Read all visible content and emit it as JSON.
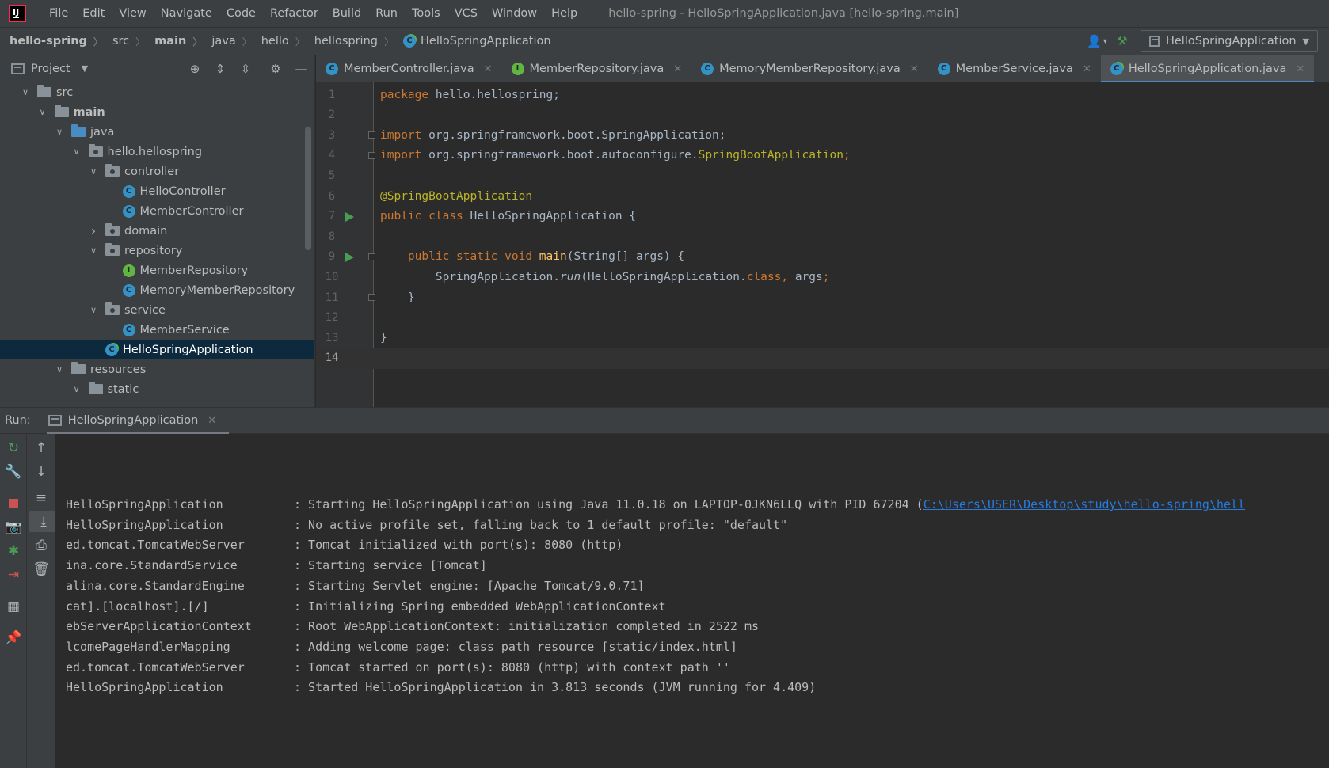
{
  "menubar": {
    "items": [
      "File",
      "Edit",
      "View",
      "Navigate",
      "Code",
      "Refactor",
      "Build",
      "Run",
      "Tools",
      "VCS",
      "Window",
      "Help"
    ],
    "window_title": "hello-spring - HelloSpringApplication.java [hello-spring.main]"
  },
  "breadcrumbs": [
    "hello-spring",
    "src",
    "main",
    "java",
    "hello",
    "hellospring",
    "HelloSpringApplication"
  ],
  "run_config": {
    "label": "HelloSpringApplication"
  },
  "project_panel": {
    "title": "Project",
    "tree": [
      {
        "label": "src",
        "depth": 1,
        "kind": "folder",
        "expanded": true
      },
      {
        "label": "main",
        "depth": 2,
        "kind": "folder",
        "expanded": true,
        "bold": true
      },
      {
        "label": "java",
        "depth": 3,
        "kind": "src-folder",
        "expanded": true
      },
      {
        "label": "hello.hellospring",
        "depth": 4,
        "kind": "package",
        "expanded": true
      },
      {
        "label": "controller",
        "depth": 5,
        "kind": "package",
        "expanded": true
      },
      {
        "label": "HelloController",
        "depth": 6,
        "kind": "class"
      },
      {
        "label": "MemberController",
        "depth": 6,
        "kind": "class"
      },
      {
        "label": "domain",
        "depth": 5,
        "kind": "package",
        "expanded": false
      },
      {
        "label": "repository",
        "depth": 5,
        "kind": "package",
        "expanded": true
      },
      {
        "label": "MemberRepository",
        "depth": 6,
        "kind": "interface"
      },
      {
        "label": "MemoryMemberRepository",
        "depth": 6,
        "kind": "class"
      },
      {
        "label": "service",
        "depth": 5,
        "kind": "package",
        "expanded": true
      },
      {
        "label": "MemberService",
        "depth": 6,
        "kind": "class"
      },
      {
        "label": "HelloSpringApplication",
        "depth": 5,
        "kind": "class-run",
        "selected": true
      },
      {
        "label": "resources",
        "depth": 3,
        "kind": "res-folder",
        "expanded": true
      },
      {
        "label": "static",
        "depth": 4,
        "kind": "folder",
        "expanded": true
      }
    ]
  },
  "editor_tabs": [
    {
      "label": "MemberController.java",
      "kind": "class",
      "active": false
    },
    {
      "label": "MemberRepository.java",
      "kind": "interface",
      "active": false
    },
    {
      "label": "MemoryMemberRepository.java",
      "kind": "class",
      "active": false
    },
    {
      "label": "MemberService.java",
      "kind": "class",
      "active": false
    },
    {
      "label": "HelloSpringApplication.java",
      "kind": "class-run",
      "active": true
    }
  ],
  "code": {
    "line_numbers": [
      "1",
      "2",
      "3",
      "4",
      "5",
      "6",
      "7",
      "8",
      "9",
      "10",
      "11",
      "12",
      "13",
      "14"
    ],
    "current_line": "14",
    "l1": {
      "kw": "package",
      "rest": " hello.hellospring;"
    },
    "l3": {
      "kw": "import",
      "rest": " org.springframework.boot.SpringApplication;"
    },
    "l4": {
      "kw": "import",
      "rest": " org.springframework.boot.autoconfigure.",
      "ann": "SpringBootApplication",
      "semi": ";"
    },
    "l6": {
      "ann": "@SpringBootApplication"
    },
    "l7": {
      "kw": "public class",
      "rest": " HelloSpringApplication {"
    },
    "l9": {
      "kw": "public static void",
      "fn": "main",
      "rest": "(String[] args) {"
    },
    "l10": {
      "a": "SpringApplication.",
      "it": "run",
      "b": "(HelloSpringApplication.",
      "kw": "class",
      "c": ", args",
      "semi": ";"
    },
    "l11": {
      "rest": "}"
    },
    "l13": {
      "rest": "}"
    }
  },
  "run_panel": {
    "label": "Run:",
    "tab_label": "HelloSpringApplication"
  },
  "console": {
    "lines": [
      {
        "logger": "HelloSpringApplication",
        "msg": ": Starting HelloSpringApplication using Java 11.0.18 on LAPTOP-0JKN6LLQ with PID 67204 (",
        "link": "C:\\Users\\USER\\Desktop\\study\\hello-spring\\hell"
      },
      {
        "logger": "HelloSpringApplication",
        "msg": ": No active profile set, falling back to 1 default profile: \"default\""
      },
      {
        "logger": "ed.tomcat.TomcatWebServer",
        "msg": ": Tomcat initialized with port(s): 8080 (http)"
      },
      {
        "logger": "ina.core.StandardService",
        "msg": ": Starting service [Tomcat]"
      },
      {
        "logger": "alina.core.StandardEngine",
        "msg": ": Starting Servlet engine: [Apache Tomcat/9.0.71]"
      },
      {
        "logger": "cat].[localhost].[/]",
        "msg": ": Initializing Spring embedded WebApplicationContext"
      },
      {
        "logger": "ebServerApplicationContext",
        "msg": ": Root WebApplicationContext: initialization completed in 2522 ms"
      },
      {
        "logger": "lcomePageHandlerMapping",
        "msg": ": Adding welcome page: class path resource [static/index.html]"
      },
      {
        "logger": "ed.tomcat.TomcatWebServer",
        "msg": ": Tomcat started on port(s): 8080 (http) with context path ''"
      },
      {
        "logger": "HelloSpringApplication",
        "msg": ": Started HelloSpringApplication in 3.813 seconds (JVM running for 4.409)"
      }
    ]
  },
  "colors": {
    "keyword": "#cc7832",
    "annotation": "#bbb529",
    "function": "#ffc66d",
    "link": "#287bde",
    "selection": "#0d293e"
  }
}
